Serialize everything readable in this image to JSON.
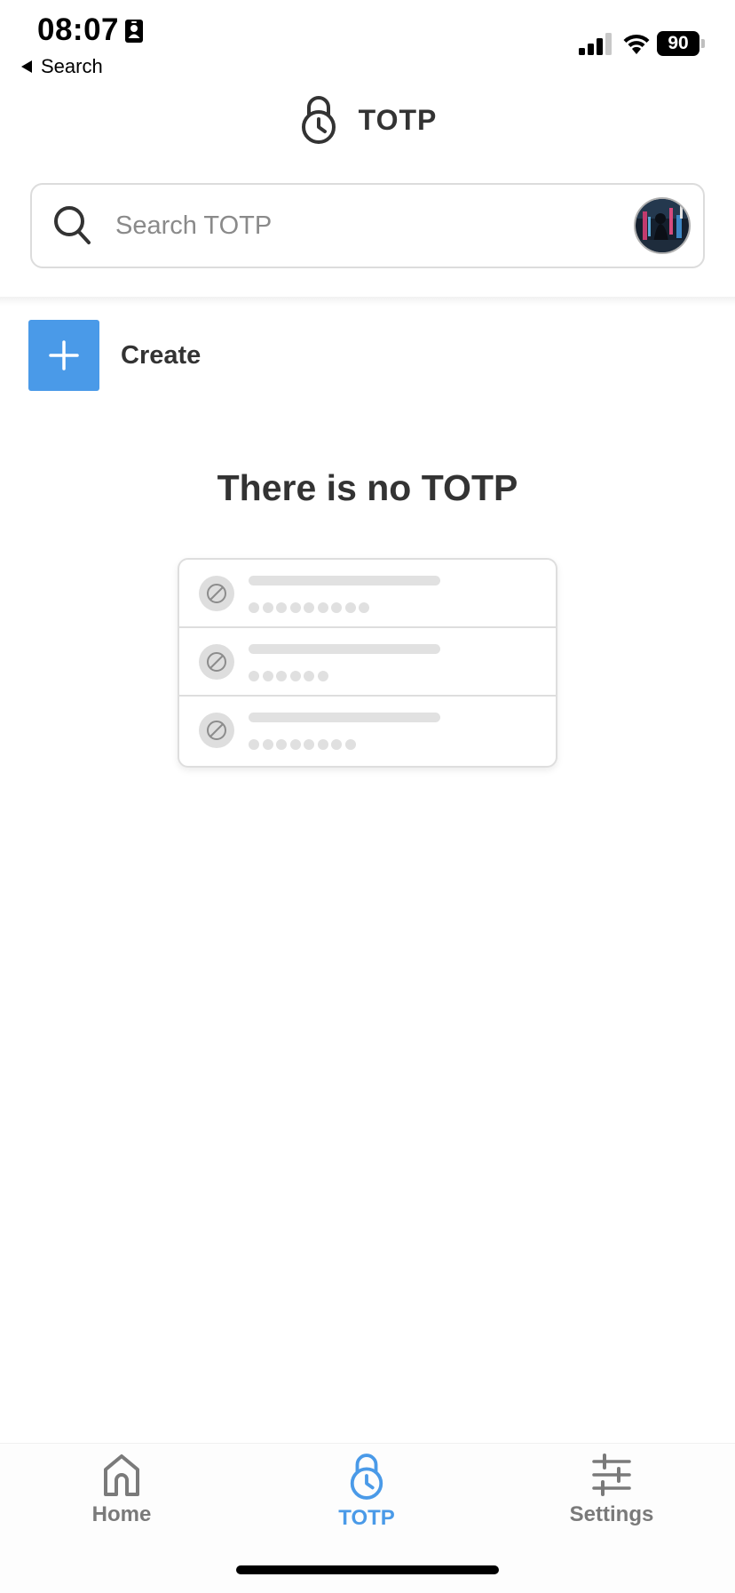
{
  "status_bar": {
    "time": "08:07",
    "back_label": "Search",
    "battery": "90"
  },
  "header": {
    "title": "TOTP",
    "icon": "lock-clock-icon"
  },
  "search": {
    "placeholder": "Search TOTP",
    "value": ""
  },
  "create": {
    "label": "Create"
  },
  "empty_state": {
    "title": "There is no TOTP",
    "placeholder_rows": [
      {
        "dots": 9
      },
      {
        "dots": 6
      },
      {
        "dots": 8
      }
    ]
  },
  "tab_bar": {
    "tabs": [
      {
        "label": "Home",
        "icon": "home-icon",
        "active": false
      },
      {
        "label": "TOTP",
        "icon": "lock-clock-icon",
        "active": true
      },
      {
        "label": "Settings",
        "icon": "sliders-icon",
        "active": false
      }
    ]
  },
  "colors": {
    "accent": "#4a9ae8",
    "text": "#333333",
    "muted": "#7a7a7a"
  }
}
